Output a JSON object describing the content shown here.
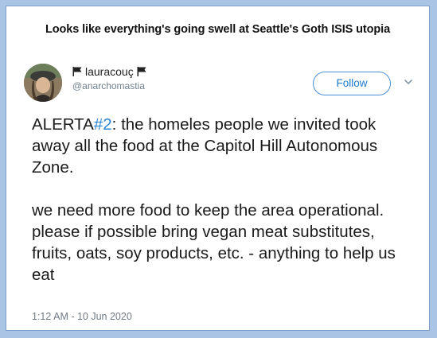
{
  "caption": "Looks like everything's going swell at Seattle's Goth ISIS utopia",
  "tweet": {
    "display_name": "lauracouç",
    "handle": "@anarchomastia",
    "follow_label": "Follow",
    "paragraph1_prefix": "ALERTA",
    "hashtag": "#2",
    "paragraph1_rest": ": the homeles people we invited took away all the food at the Capitol Hill Autonomous Zone.",
    "paragraph2": "we need more food to keep the area operational. please if possible bring vegan meat substitutes, fruits, oats, soy products, etc. - anything to help us eat",
    "timestamp": "1:12 AM - 10 Jun 2020",
    "icons": [
      "avatar",
      "black-flag-icon",
      "chevron-down-icon"
    ]
  },
  "colors": {
    "background_border": "#a9c4e4",
    "link_blue": "#2b85d6",
    "follow_border": "#4a90d9"
  }
}
